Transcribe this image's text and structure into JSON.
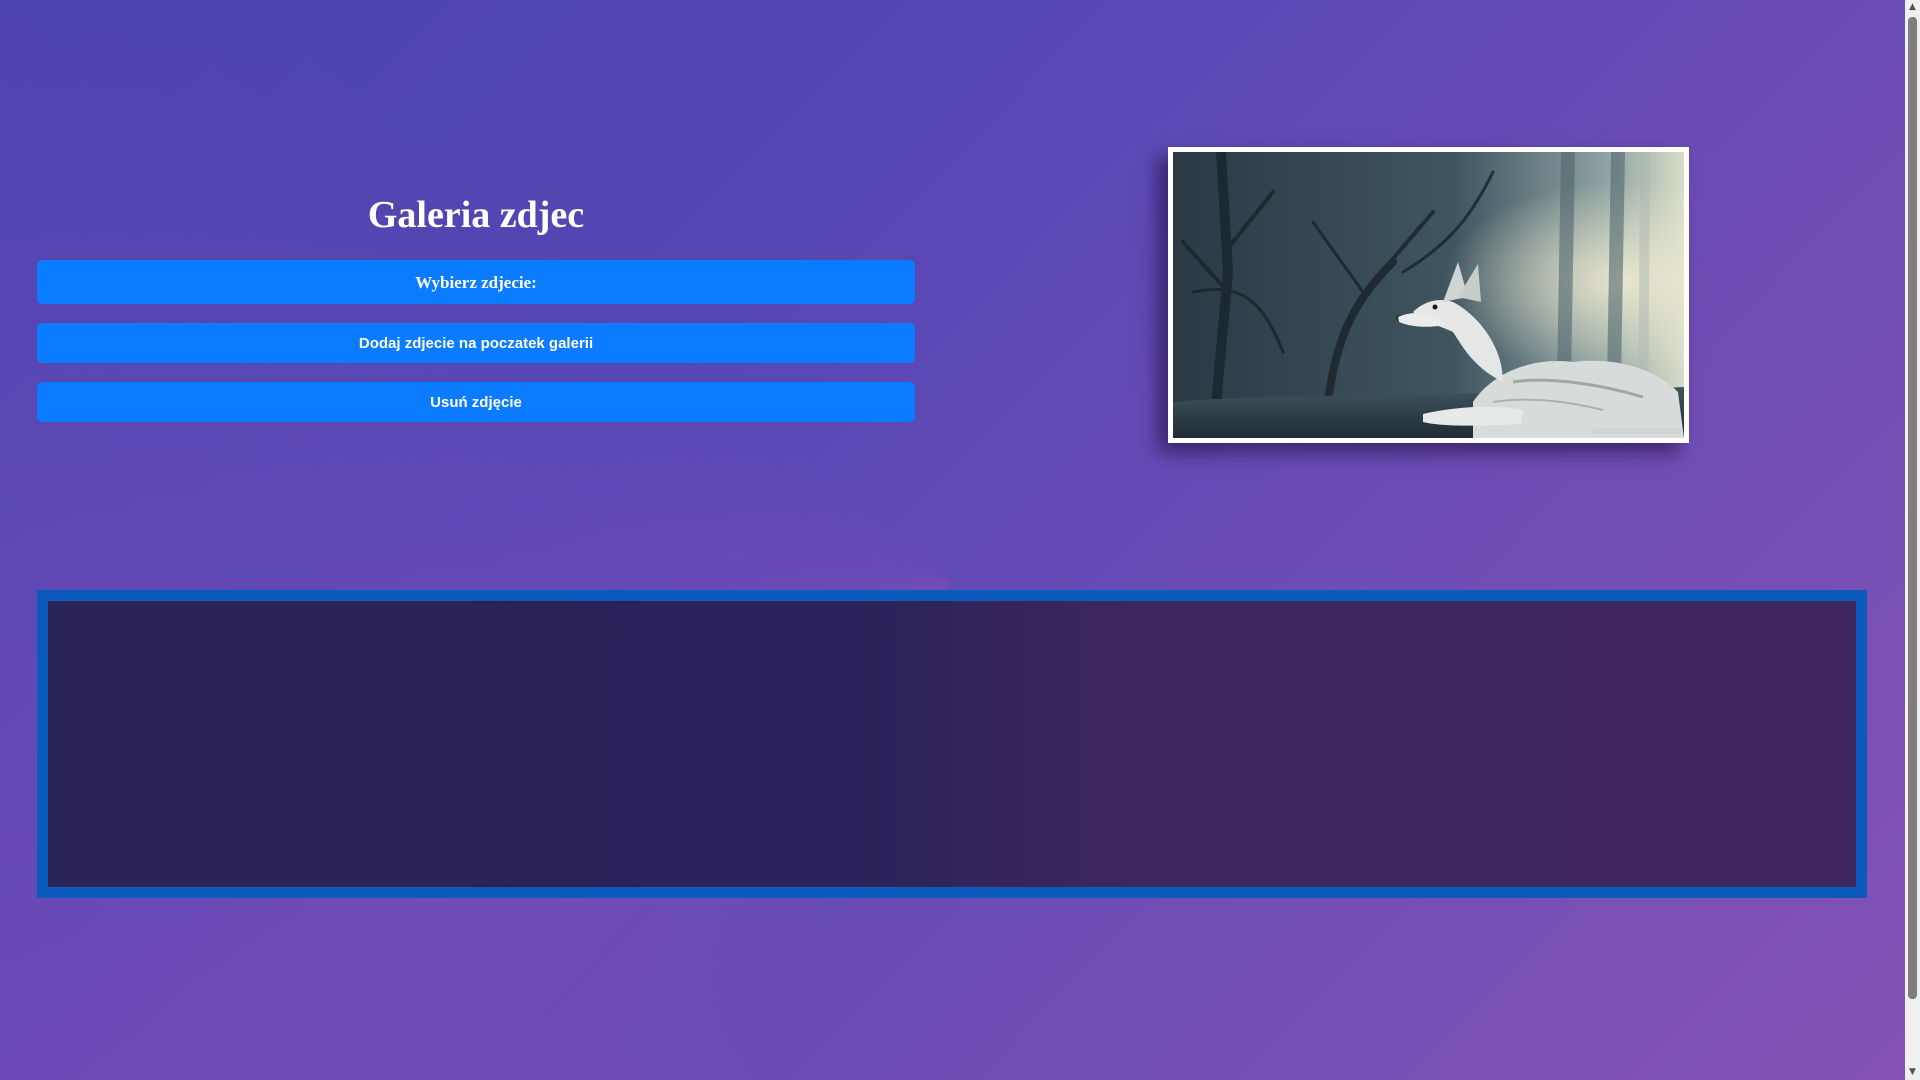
{
  "gallery": {
    "title": "Galeria zdjec",
    "choose_label": "Wybierz zdjecie:",
    "add_label": "Dodaj zdjecie na poczatek galerii",
    "remove_label": "Usuń zdjęcie"
  },
  "preview": {
    "image_subject": "white-wolf-in-forest"
  },
  "colors": {
    "button_bg": "#0b7bff",
    "strip_border": "#0a5bbc",
    "background_start": "#4b44ae",
    "background_end": "#8452b3"
  },
  "scrollbar": {
    "up_icon": "chevron-up-icon",
    "down_icon": "chevron-down-icon"
  }
}
